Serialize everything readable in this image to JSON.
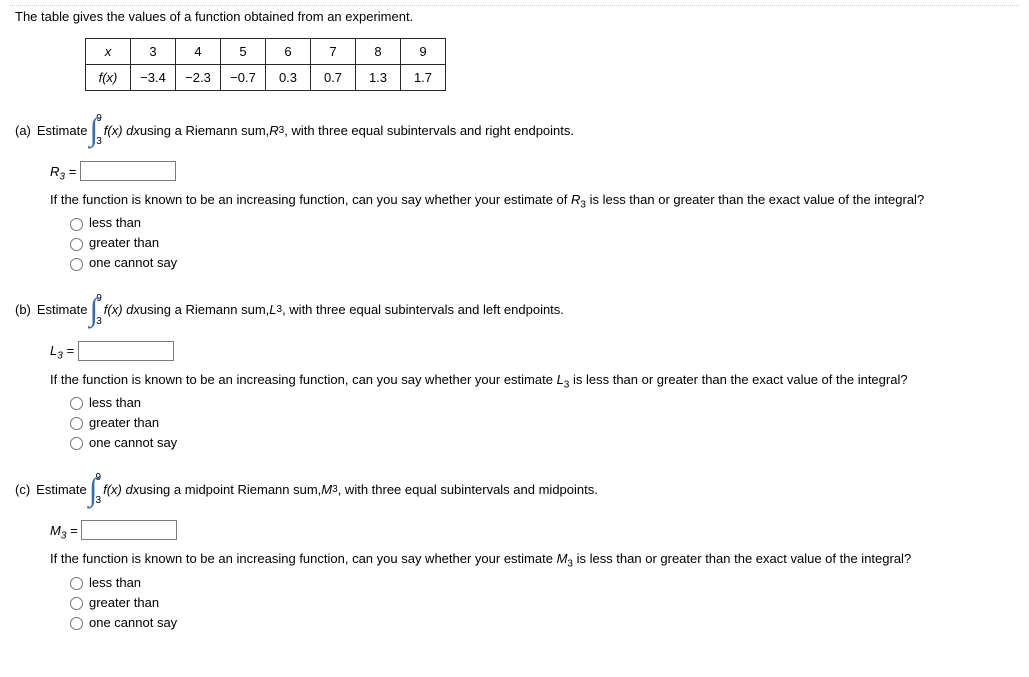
{
  "intro": "The table gives the values of a function obtained from an experiment.",
  "table": {
    "row1": [
      "x",
      "3",
      "4",
      "5",
      "6",
      "7",
      "8",
      "9"
    ],
    "row2": [
      "f(x)",
      "−3.4",
      "−2.3",
      "−0.7",
      "0.3",
      "0.7",
      "1.3",
      "1.7"
    ]
  },
  "integral": {
    "upper": "9",
    "lower": "3",
    "integrand": "f(x) dx"
  },
  "parts": {
    "a": {
      "label": "(a)",
      "pre": "Estimate",
      "post1": " using a Riemann sum, ",
      "sym": "R",
      "sub": "3",
      "post2": ", with three equal subintervals and right endpoints.",
      "ansLabel": "R",
      "ansSub": "3",
      "follow1": "If the function is known to be an increasing function, can you say whether your estimate of ",
      "follow2": " is less than or greater than the exact value of the integral?"
    },
    "b": {
      "label": "(b)",
      "pre": "Estimate",
      "post1": " using a Riemann sum, ",
      "sym": "L",
      "sub": "3",
      "post2": ", with three equal subintervals and left endpoints.",
      "ansLabel": "L",
      "ansSub": "3",
      "follow1": "If the function is known to be an increasing function, can you say whether your estimate ",
      "follow2": " is less than or greater than the exact value of the integral?"
    },
    "c": {
      "label": "(c)",
      "pre": "Estimate",
      "post1": " using a midpoint Riemann sum, ",
      "sym": "M",
      "sub": "3",
      "post2": ", with three equal subintervals and midpoints.",
      "ansLabel": "M",
      "ansSub": "3",
      "follow1": "If the function is known to be an increasing function, can you say whether your estimate ",
      "follow2": " is less than or greater than the exact value of the integral?"
    }
  },
  "options": {
    "o1": "less than",
    "o2": "greater than",
    "o3": "one cannot say"
  },
  "chart_data": {
    "type": "table",
    "x": [
      3,
      4,
      5,
      6,
      7,
      8,
      9
    ],
    "fx": [
      -3.4,
      -2.3,
      -0.7,
      0.3,
      0.7,
      1.3,
      1.7
    ]
  }
}
